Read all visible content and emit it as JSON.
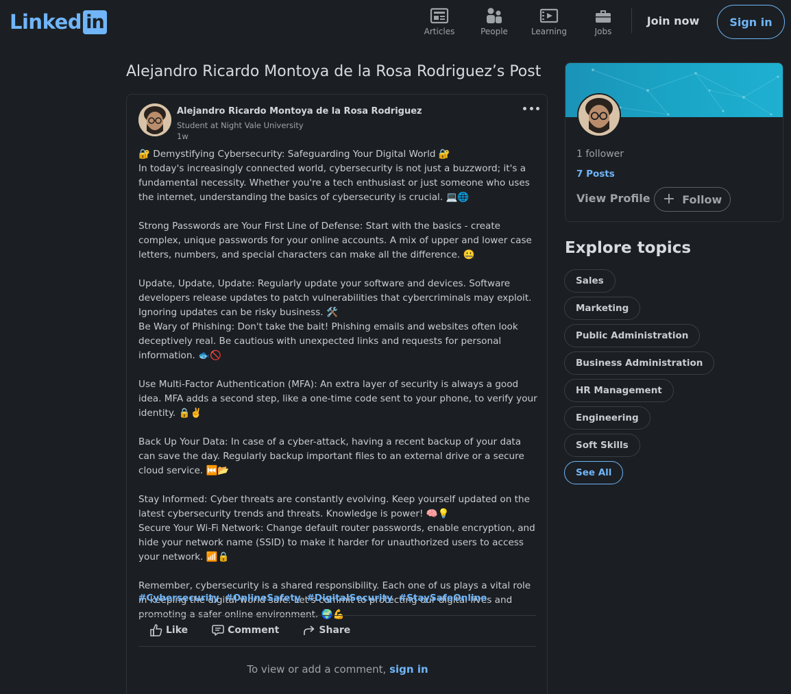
{
  "header": {
    "logo_text": "Linked",
    "logo_box": "in",
    "nav": [
      {
        "label": "Articles",
        "icon": "articles-icon"
      },
      {
        "label": "People",
        "icon": "people-icon"
      },
      {
        "label": "Learning",
        "icon": "learning-icon"
      },
      {
        "label": "Jobs",
        "icon": "jobs-icon"
      }
    ],
    "join_label": "Join now",
    "signin_label": "Sign in"
  },
  "page_title": "Alejandro Ricardo Montoya de la Rosa Rodriguez’s Post",
  "post": {
    "author": "Alejandro Ricardo Montoya de la Rosa Rodriguez",
    "subtitle": "Student at Night Vale University",
    "time": "1w",
    "paragraphs": [
      "🔐 Demystifying Cybersecurity: Safeguarding Your Digital World 🔐",
      "In today's increasingly connected world, cybersecurity is not just a buzzword; it's a fundamental necessity. Whether you're a tech enthusiast or just someone who uses the internet, understanding the basics of cybersecurity is crucial. 💻🌐",
      "",
      "Strong Passwords are Your First Line of Defense: Start with the basics - create complex, unique passwords for your online accounts. A mix of upper and lower case letters, numbers, and special characters can make all the difference. 🤐",
      "",
      "Update, Update, Update: Regularly update your software and devices. Software developers release updates to patch vulnerabilities that cybercriminals may exploit. Ignoring updates can be risky business. 🛠️",
      "Be Wary of Phishing: Don't take the bait! Phishing emails and websites often look deceptively real. Be cautious with unexpected links and requests for personal information. 🐟🚫",
      "",
      "Use Multi-Factor Authentication (MFA): An extra layer of security is always a good idea. MFA adds a second step, like a one-time code sent to your phone, to verify your identity. 🔒✌️",
      "",
      "Back Up Your Data: In case of a cyber-attack, having a recent backup of your data can save the day. Regularly backup important files to an external drive or a secure cloud service. ⏮️📂",
      "",
      "Stay Informed: Cyber threats are constantly evolving. Keep yourself updated on the latest cybersecurity trends and threats. Knowledge is power! 🧠💡",
      "Secure Your Wi-Fi Network: Change default router passwords, enable encryption, and hide your network name (SSID) to make it harder for unauthorized users to access your network. 📶🔒",
      "",
      "Remember, cybersecurity is a shared responsibility. Each one of us plays a vital role in keeping the digital world safe. Let's commit to protecting our digital lives and promoting a safer online environment. 🌍💪"
    ],
    "hashtags": [
      "#Cybersecurity",
      "#OnlineSafety",
      "#DigitalSecurity",
      "#StaySafeOnline"
    ],
    "actions": {
      "like": "Like",
      "comment": "Comment",
      "share": "Share"
    },
    "comment_prompt": "To view or add a comment,",
    "comment_link": "sign in"
  },
  "profile": {
    "followers": "1 follower",
    "posts": "7 Posts",
    "view_profile": "View Profile",
    "follow": "Follow"
  },
  "explore": {
    "title": "Explore topics",
    "topics": [
      "Sales",
      "Marketing",
      "Public Administration",
      "Business Administration",
      "HR Management",
      "Engineering",
      "Soft Skills"
    ],
    "see_all": "See All"
  },
  "colors": {
    "accent": "#70b5f9",
    "background": "#1b1f23",
    "banner": "#1aa5c6"
  }
}
